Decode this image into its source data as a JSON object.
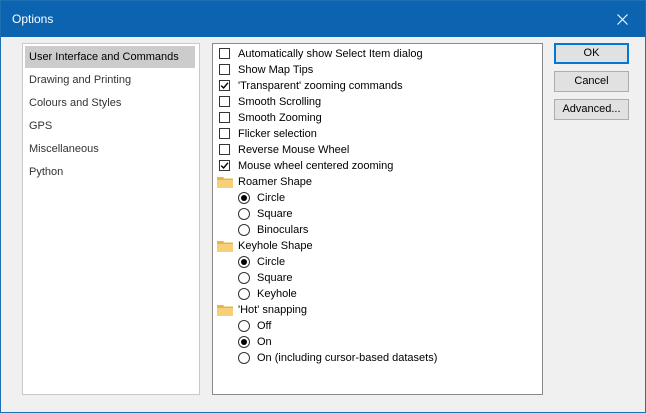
{
  "window": {
    "title": "Options"
  },
  "categories": [
    {
      "label": "User Interface and Commands",
      "selected": true
    },
    {
      "label": "Drawing and Printing"
    },
    {
      "label": "Colours and Styles"
    },
    {
      "label": "GPS"
    },
    {
      "label": "Miscellaneous"
    },
    {
      "label": "Python"
    }
  ],
  "options": {
    "checkboxes": [
      {
        "label": "Automatically show Select Item dialog",
        "checked": false
      },
      {
        "label": "Show Map Tips",
        "checked": false
      },
      {
        "label": "'Transparent' zooming commands",
        "checked": true
      },
      {
        "label": "Smooth Scrolling",
        "checked": false
      },
      {
        "label": "Smooth Zooming",
        "checked": false
      },
      {
        "label": "Flicker selection",
        "checked": false
      },
      {
        "label": "Reverse Mouse Wheel",
        "checked": false
      },
      {
        "label": "Mouse wheel centered zooming",
        "checked": true
      }
    ],
    "groups": [
      {
        "label": "Roamer Shape",
        "choices": [
          {
            "label": "Circle",
            "selected": true
          },
          {
            "label": "Square",
            "selected": false
          },
          {
            "label": "Binoculars",
            "selected": false
          }
        ]
      },
      {
        "label": "Keyhole Shape",
        "choices": [
          {
            "label": "Circle",
            "selected": true
          },
          {
            "label": "Square",
            "selected": false
          },
          {
            "label": "Keyhole",
            "selected": false
          }
        ]
      },
      {
        "label": "'Hot' snapping",
        "choices": [
          {
            "label": "Off",
            "selected": false
          },
          {
            "label": "On",
            "selected": true
          },
          {
            "label": "On (including cursor-based datasets)",
            "selected": false
          }
        ]
      }
    ]
  },
  "buttons": {
    "ok": "OK",
    "cancel": "Cancel",
    "advanced": "Advanced..."
  },
  "colors": {
    "titlebar": "#0c64b0",
    "selection": "#cccccc",
    "folder": "#e8b54a"
  },
  "icons": {
    "close": "close-icon",
    "folder": "folder-icon"
  }
}
